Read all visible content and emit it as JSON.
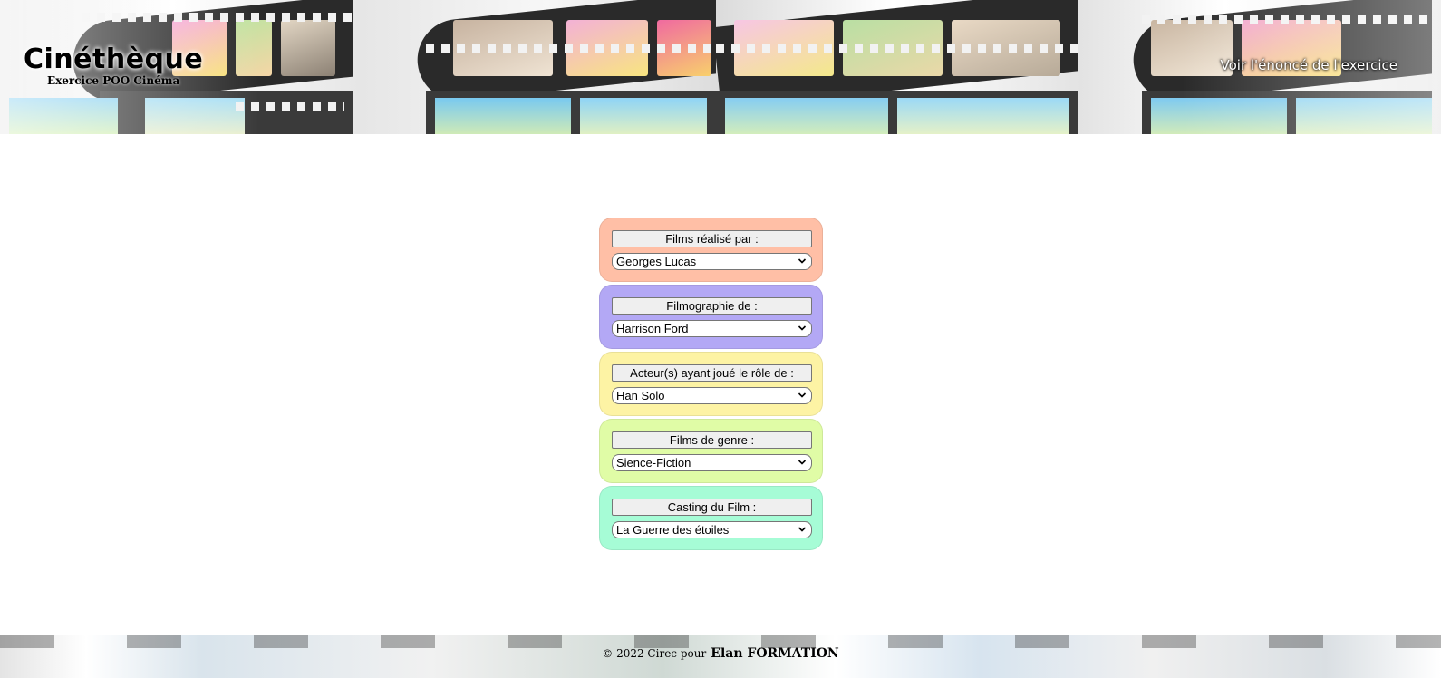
{
  "header": {
    "title": "Cinéthèque",
    "subtitle": "Exercice POO Cinéma",
    "enonce_link": "Voir l'énoncé de l'exercice"
  },
  "panels": [
    {
      "button_label": "Films réalisé par :",
      "selected": "Georges Lucas",
      "color": "#ffbfa6"
    },
    {
      "button_label": "Filmographie de :",
      "selected": "Harrison Ford",
      "color": "#b3a8f5"
    },
    {
      "button_label": "Acteur(s) ayant joué le rôle de :",
      "selected": "Han Solo",
      "color": "#fdf3a4"
    },
    {
      "button_label": "Films de genre :",
      "selected": "Sience-Fiction",
      "color": "#e0fca6"
    },
    {
      "button_label": "Casting du Film :",
      "selected": "La Guerre des étoiles",
      "color": "#a6fcd6"
    }
  ],
  "footer": {
    "copyright": "© 2022 Cirec pour",
    "company": "Elan FORMATION"
  },
  "icons": {
    "select_arrow": "chevron-down-icon",
    "banner": "film-strip-image"
  }
}
